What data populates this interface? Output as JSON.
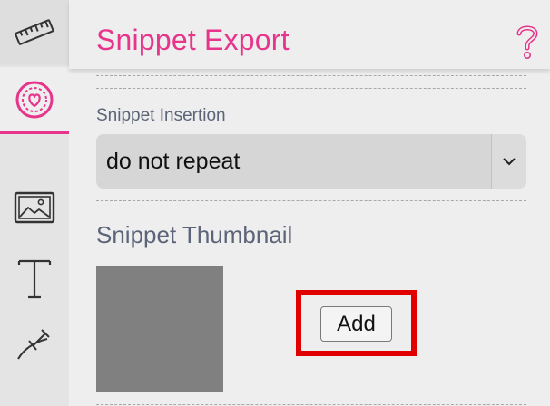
{
  "colors": {
    "accent": "#e6358b",
    "highlight": "#e00000",
    "thumbnail": "#808080"
  },
  "sidebar": {
    "items": [
      {
        "icon": "ruler-icon"
      },
      {
        "icon": "heart-badge-icon",
        "active": true
      },
      {
        "icon": "image-icon"
      },
      {
        "icon": "text-icon"
      },
      {
        "icon": "curve-tool-icon"
      }
    ]
  },
  "header": {
    "title": "Snippet Export",
    "help_icon": "question-mark-icon"
  },
  "insertion": {
    "label": "Snippet Insertion",
    "selected": "do not repeat",
    "arrow_icon": "chevron-down-icon"
  },
  "thumbnail": {
    "label": "Snippet Thumbnail",
    "add_label": "Add"
  }
}
